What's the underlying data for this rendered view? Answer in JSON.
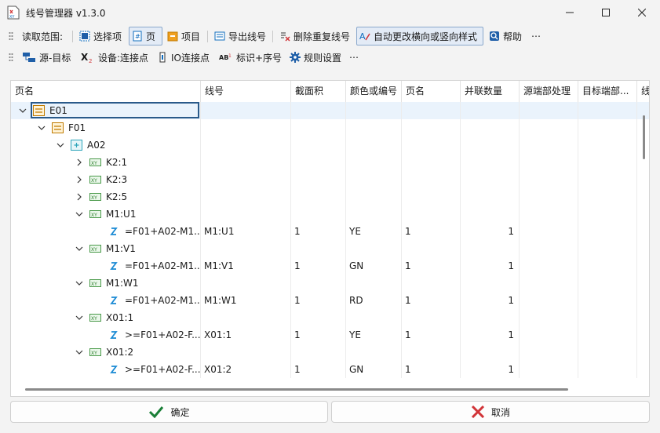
{
  "window": {
    "title": "线号管理器 v1.3.0"
  },
  "toolbar1": {
    "read_scope_label": "读取范围:",
    "select_item": "选择项",
    "page": "页",
    "project": "项目",
    "export_wire_number": "导出线号",
    "delete_duplicate": "删除重复线号",
    "auto_change_style": "自动更改横向或竖向样式",
    "help": "帮助",
    "more": "⋯"
  },
  "toolbar2": {
    "source_target": "源-目标",
    "device_connection": "设备:连接点",
    "io_connection": "IO连接点",
    "label_sequence": "标识+序号",
    "rule_settings": "规则设置",
    "more": "⋯"
  },
  "grid": {
    "columns": [
      "页名",
      "线号",
      "截面积",
      "颜色或编号",
      "页名",
      "并联数量",
      "源端部处理",
      "目标端部...",
      "线"
    ],
    "tree": [
      {
        "label": "E01",
        "icon": "page-group-icon",
        "expanded": true,
        "selected": true
      },
      {
        "label": "F01",
        "icon": "page-group-icon",
        "expanded": true
      },
      {
        "label": "A02",
        "icon": "location-icon",
        "expanded": true
      },
      {
        "label": "K2:1",
        "icon": "xy-device-icon",
        "expanded": false
      },
      {
        "label": "K2:3",
        "icon": "xy-device-icon",
        "expanded": false
      },
      {
        "label": "K2:5",
        "icon": "xy-device-icon",
        "expanded": false
      },
      {
        "label": "M1:U1",
        "icon": "xy-device-icon",
        "expanded": true
      },
      {
        "label": "=F01+A02-M1...",
        "icon": "wire-icon",
        "wire": "M1:U1",
        "area": "1",
        "color": "YE",
        "page": "1",
        "count": "1"
      },
      {
        "label": "M1:V1",
        "icon": "xy-device-icon",
        "expanded": true
      },
      {
        "label": "=F01+A02-M1...",
        "icon": "wire-icon",
        "wire": "M1:V1",
        "area": "1",
        "color": "GN",
        "page": "1",
        "count": "1"
      },
      {
        "label": "M1:W1",
        "icon": "xy-device-icon",
        "expanded": true
      },
      {
        "label": "=F01+A02-M1...",
        "icon": "wire-icon",
        "wire": "M1:W1",
        "area": "1",
        "color": "RD",
        "page": "1",
        "count": "1"
      },
      {
        "label": "X01:1",
        "icon": "xy-device-icon",
        "expanded": true
      },
      {
        "label": ">=F01+A02-F...",
        "icon": "wire-icon",
        "wire": "X01:1",
        "area": "1",
        "color": "YE",
        "page": "1",
        "count": "1"
      },
      {
        "label": "X01:2",
        "icon": "xy-device-icon",
        "expanded": true
      },
      {
        "label": ">=F01+A02-F...",
        "icon": "wire-icon",
        "wire": "X01:2",
        "area": "1",
        "color": "GN",
        "page": "1",
        "count": "1"
      }
    ]
  },
  "footer": {
    "ok_label": "确定",
    "cancel_label": "取消"
  },
  "colors": {
    "accent": "#0f6cbd",
    "ok_green": "#1a7f37",
    "cancel_red": "#d13438",
    "selected_row": "#eaf3fc"
  }
}
